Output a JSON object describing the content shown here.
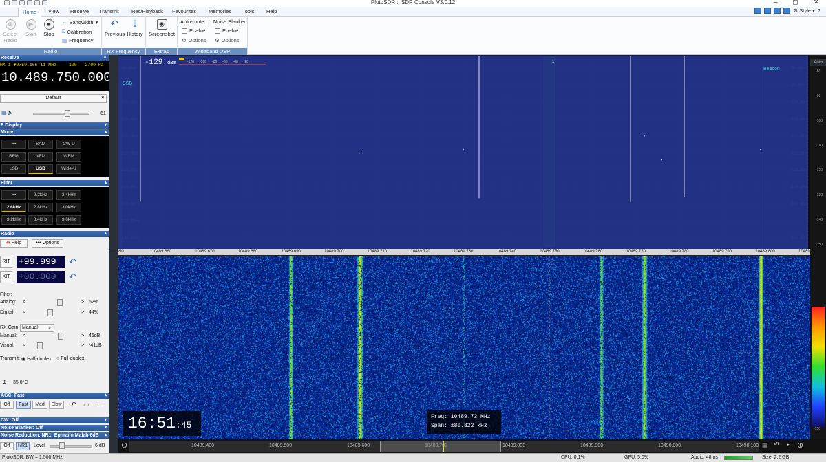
{
  "window": {
    "title": "PlutoSDR :: SDR Console V3.0.12",
    "style_label": "Style"
  },
  "ribbon": {
    "tabs": [
      "Home",
      "View",
      "Receive",
      "Transmit",
      "Rec/Playback",
      "Favourites",
      "Memories",
      "Tools",
      "Help"
    ],
    "active_tab": "Home",
    "radio": {
      "select": "Select Radio",
      "start": "Start",
      "stop": "Stop",
      "bandwidth": "Bandwidth",
      "calibration": "Calibration",
      "frequency": "Frequency",
      "group": "Radio"
    },
    "rxfreq": {
      "previous": "Previous",
      "history": "History",
      "group": "RX Frequency"
    },
    "extras": {
      "screenshot": "Screenshot",
      "group": "Extras"
    },
    "dsp": {
      "automute": "Auto-mute:",
      "noise_blanker": "Noise Blanker",
      "enable1": "Enable",
      "enable2": "Enable",
      "options1": "Options",
      "options2": "Options",
      "group": "Wideband DSP"
    }
  },
  "receive": {
    "header": "Receive",
    "info": "RX 1  ▼9750.165.11 MHz",
    "filter_range": "100 - 2700 Hz",
    "frequency": "10.489.750.000",
    "preset": "Default",
    "volume": "61",
    "volume_level": 0.61
  },
  "display_header": "F Display",
  "mode": {
    "header": "Mode",
    "buttons": [
      "•••",
      "SAM",
      "CW-U",
      "BFM",
      "NFM",
      "WFM",
      "LSB",
      "USB",
      "Wide-U"
    ],
    "selected": "USB"
  },
  "filter": {
    "header": "Filter",
    "buttons": [
      "•••",
      "2.2kHz",
      "2.4kHz",
      "2.6kHz",
      "2.8kHz",
      "3.0kHz",
      "3.2kHz",
      "3.4kHz",
      "3.6kHz"
    ],
    "selected": "2.6kHz"
  },
  "radio": {
    "header": "Radio",
    "help": "Help",
    "options": "••• Options",
    "rit_label": "RIT",
    "rit_value": "+99.999",
    "xit_label": "XIT",
    "xit_value": "+00.000",
    "filter_label": "Filter:",
    "analog_label": "Analog:",
    "analog_value": "62%",
    "analog_level": 0.62,
    "digital_label": "Digital:",
    "digital_value": "44%",
    "digital_level": 0.44,
    "rxgain_label": "RX Gain:",
    "rxgain_value": "Manual",
    "manual_label": "Manual:",
    "manual_value": "46dB",
    "visual_label": "Visual:",
    "visual_value": "-41dB",
    "transmit_label": "Transmit:",
    "half_duplex": "Half-duplex",
    "full_duplex": "Full-duplex",
    "temperature": "35.0°C"
  },
  "agc": {
    "header": "AGC: Fast",
    "buttons": [
      "Off",
      "Fast",
      "Med",
      "Slow"
    ],
    "selected": "Fast"
  },
  "cw_header": "CW: Off",
  "nb_header": "Noise Blanker: Off",
  "nr": {
    "header": "Noise Reduction: NR1: Ephraim Malah 6dB",
    "off": "Off",
    "nr1": "NR1",
    "level": "Level",
    "level_value": "6 dB"
  },
  "spectrum": {
    "level": "-129",
    "level_unit": "dBm",
    "meter_scale": [
      "-120",
      "-100",
      "-80",
      "-60",
      "-40",
      "-20"
    ],
    "db_labels": [
      "-90 dBm",
      "-95 dBm",
      "-100 dBm",
      "-105 dBm",
      "-110 dBm",
      "-115 dBm",
      "-120 dBm",
      "-125 dBm",
      "-130 dBm",
      "-135 dBm",
      "-140 dBm"
    ],
    "db_values": [
      -90,
      -95,
      -100,
      -105,
      -110,
      -115,
      -120,
      -125,
      -130,
      -135,
      -140
    ],
    "right_labels": [
      "-90 dBm",
      "-95 dBm",
      "-100 dBm",
      "-105 dBm",
      "-110 dBm",
      "-115 dBm",
      "-120 dBm",
      "-125 dBm",
      "-130 dBm",
      "-140 dBm"
    ],
    "right_values": [
      -90,
      -95,
      -100,
      -105,
      -110,
      -115,
      -120,
      -125,
      -130,
      -140
    ],
    "left_marker": "SSB",
    "right_marker": "Beacon",
    "rx_marker": "1",
    "freq_ticks": [
      "489.650",
      "10489.660",
      "10489.670",
      "10489.680",
      "10489.690",
      "10489.700",
      "10489.710",
      "10489.720",
      "10489.730",
      "10489.740",
      "10489.750",
      "10489.760",
      "10489.770",
      "10489.780",
      "10489.790",
      "10489.800",
      "10489.8"
    ],
    "freq_tick_values": [
      10489.65,
      10489.66,
      10489.67,
      10489.68,
      10489.69,
      10489.7,
      10489.71,
      10489.72,
      10489.73,
      10489.74,
      10489.75,
      10489.76,
      10489.77,
      10489.78,
      10489.79,
      10489.8,
      10489.81
    ],
    "range_mhz": [
      10489.65,
      10489.81
    ],
    "peaks": [
      {
        "freq": 10489.706,
        "dbm": -115
      },
      {
        "freq": 10489.73,
        "dbm": -114
      },
      {
        "freq": 10489.772,
        "dbm": -110
      },
      {
        "freq": 10489.776,
        "dbm": -117
      },
      {
        "freq": 10489.799,
        "dbm": -114
      }
    ],
    "auto_label": "Auto",
    "side_scale": [
      "-80",
      "-90",
      "-100",
      "-110",
      "-120",
      "-130",
      "-140",
      "-150"
    ]
  },
  "waterfall": {
    "time_main": "16:51",
    "time_sec": "45",
    "freq_line": "Freq: 10489.73 MHz",
    "span_line": "Span:  ±80.822 kHz",
    "overview_ticks": [
      "10489.400",
      "10489.500",
      "10489.600",
      "10489.700",
      "10489.800",
      "10489.900",
      "10490.000",
      "10490.100"
    ],
    "zoom": "x5",
    "side_scale": [
      "-100",
      "-110",
      "-120",
      "-130",
      "-140",
      "-150"
    ]
  },
  "status": {
    "left": "PlutoSDR, BW = 1.500 MHz",
    "cpu": "CPU: 0.1%",
    "gpu": "GPU: 5.0%",
    "audio": "Audio: 48ms",
    "size": "Size: 2.2 GB"
  },
  "colors": {
    "accent": "#2a5796",
    "spectrum_fill": "#2a3a8a",
    "waterfall_bg": "#0a0a3c",
    "rx_band": "#2fae2f"
  }
}
